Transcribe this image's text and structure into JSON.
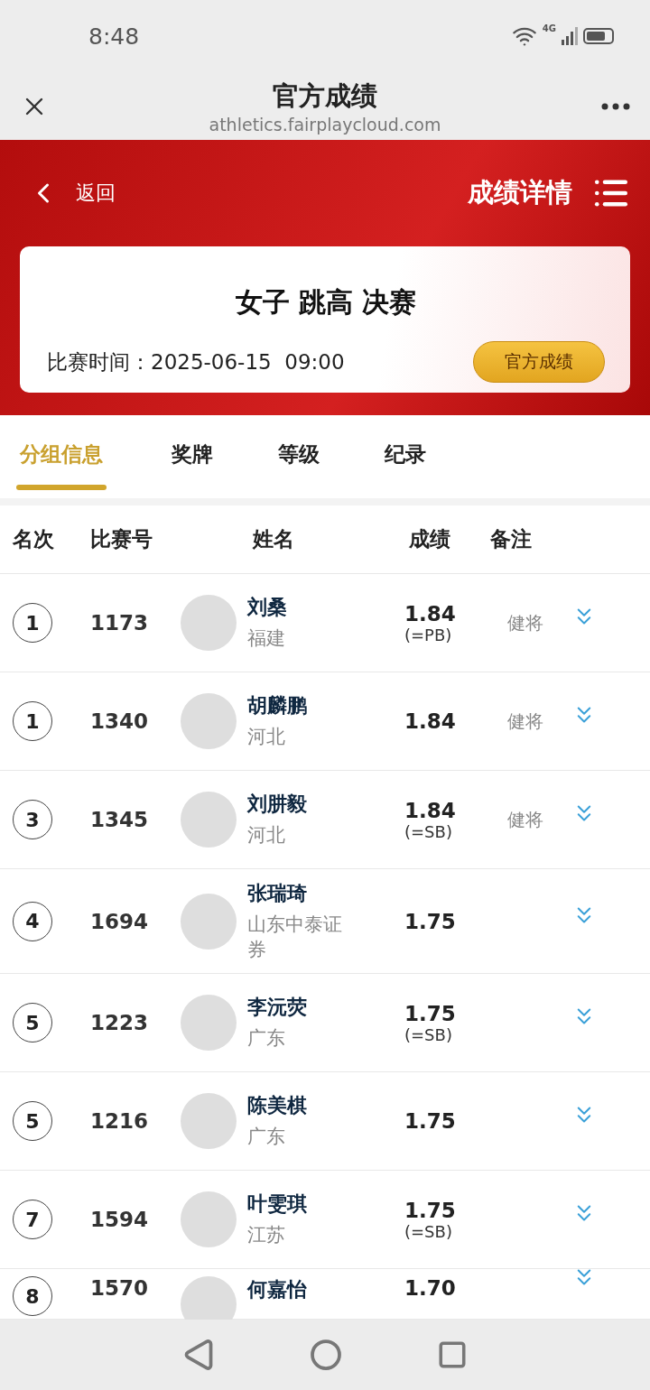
{
  "status_bar": {
    "time": "8:48",
    "network": "4G"
  },
  "browser_bar": {
    "title": "官方成绩",
    "url": "athletics.fairplaycloud.com"
  },
  "header": {
    "back_label": "返回",
    "title": "成绩详情"
  },
  "event_card": {
    "title": "女子 跳高 决赛",
    "time_label": "比赛时间：",
    "time": "2025-06-15  09:00",
    "button": "官方成绩"
  },
  "tabs": [
    {
      "label": "分组信息",
      "selected": true
    },
    {
      "label": "奖牌",
      "selected": false
    },
    {
      "label": "等级",
      "selected": false
    },
    {
      "label": "纪录",
      "selected": false
    }
  ],
  "table": {
    "columns": [
      "名次",
      "比赛号",
      "姓名",
      "成绩",
      "备注"
    ],
    "rows": [
      {
        "rank": "1",
        "bib": "1173",
        "name": "刘桑",
        "team": "福建",
        "mark": "1.84",
        "mark_note": "(=PB)",
        "remark": "健将"
      },
      {
        "rank": "1",
        "bib": "1340",
        "name": "胡麟鹏",
        "team": "河北",
        "mark": "1.84",
        "remark": "健将"
      },
      {
        "rank": "3",
        "bib": "1345",
        "name": "刘肼毅",
        "team": "河北",
        "mark": "1.84",
        "mark_note": "(=SB)",
        "remark": "健将"
      },
      {
        "rank": "4",
        "bib": "1694",
        "name": "张瑞琦",
        "team": "山东中泰证券",
        "mark": "1.75"
      },
      {
        "rank": "5",
        "bib": "1223",
        "name": "李沅荧",
        "team": "广东",
        "mark": "1.75",
        "mark_note": "(=SB)"
      },
      {
        "rank": "5",
        "bib": "1216",
        "name": "陈美棋",
        "team": "广东",
        "mark": "1.75"
      },
      {
        "rank": "7",
        "bib": "1594",
        "name": "叶雯琪",
        "team": "江苏",
        "mark": "1.75",
        "mark_note": "(=SB)"
      },
      {
        "rank": "8",
        "bib": "1570",
        "name": "何嘉怡",
        "mark": "1.70"
      }
    ]
  }
}
